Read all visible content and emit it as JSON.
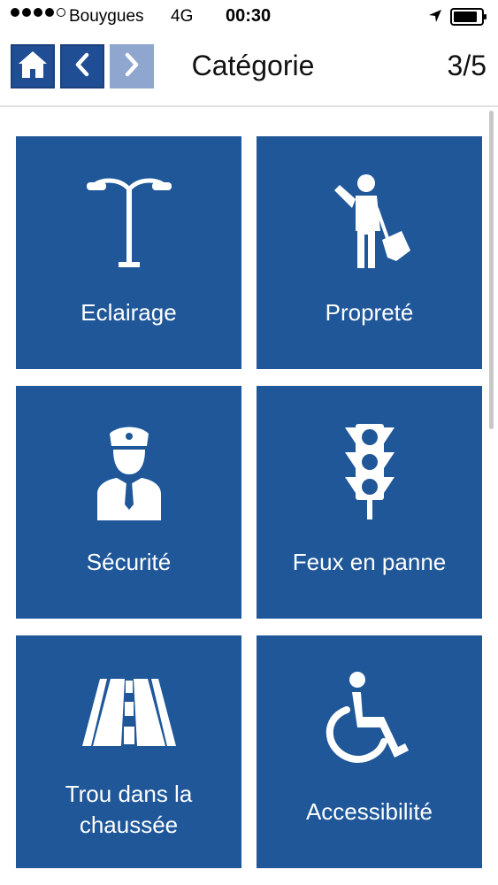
{
  "status_bar": {
    "carrier": "Bouygues",
    "network": "4G",
    "time": "00:30",
    "signal_filled": 4,
    "signal_total": 5,
    "icons": [
      "location-arrow-icon",
      "battery-icon"
    ]
  },
  "nav": {
    "title": "Catégorie",
    "counter": "3/5",
    "buttons": [
      "home-icon",
      "chevron-left-icon",
      "chevron-right-icon"
    ]
  },
  "colors": {
    "tile_blue": "#1f5799",
    "nav_blue": "#1f4e94",
    "nav_disabled": "#8fa6cf"
  },
  "categories": [
    {
      "label": "Eclairage",
      "icon": "street-lamp-icon"
    },
    {
      "label": "Propreté",
      "icon": "street-cleaner-icon"
    },
    {
      "label": "Sécurité",
      "icon": "police-officer-icon"
    },
    {
      "label": "Feux en panne",
      "icon": "traffic-light-icon"
    },
    {
      "label": "Trou dans la chaussée",
      "icon": "road-icon"
    },
    {
      "label": "Accessibilité",
      "icon": "wheelchair-icon"
    }
  ]
}
